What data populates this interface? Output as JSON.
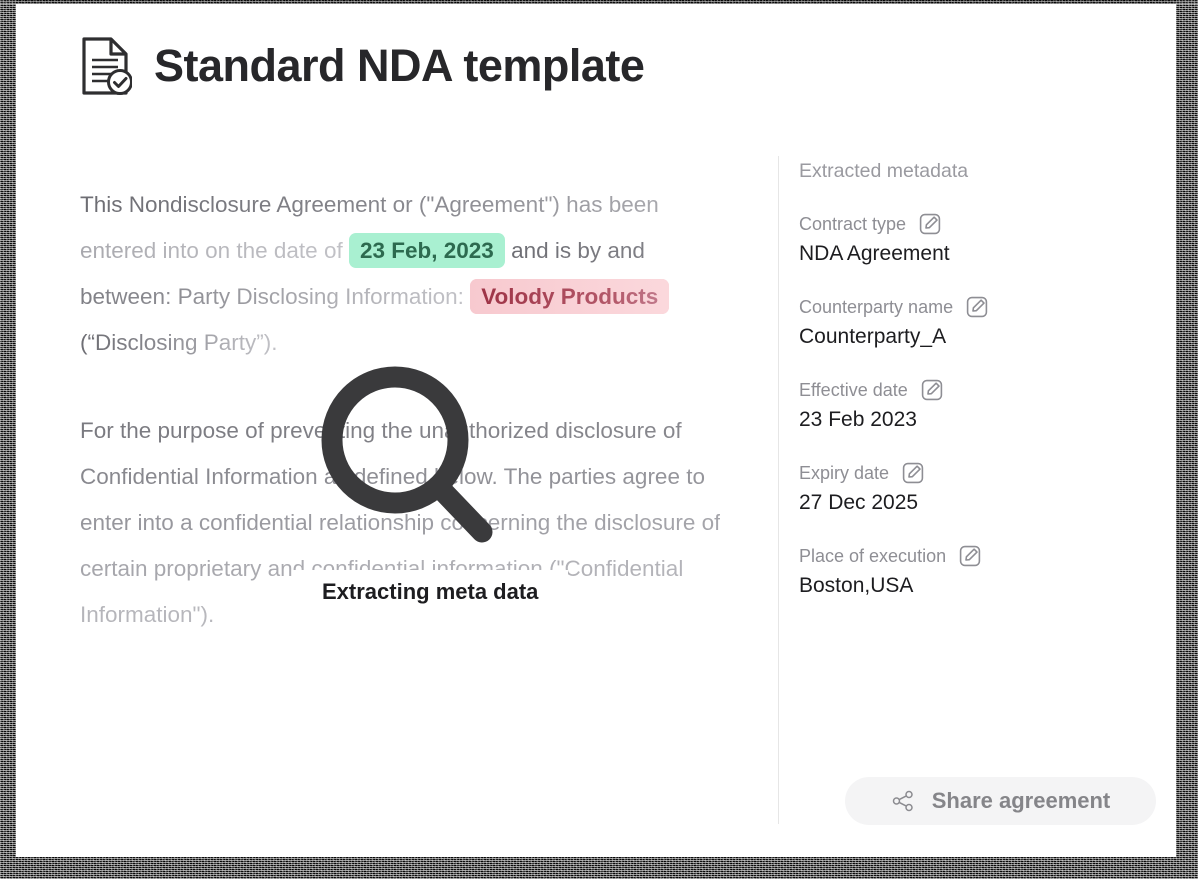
{
  "header": {
    "title": "Standard NDA template",
    "icon": "document-check-icon"
  },
  "document": {
    "paragraph1": {
      "part1": "This Nondisclosure Agreement or (\"Agreement\") has been entered into on the date of ",
      "highlight_date": "23 Feb, 2023",
      "part2": " and is by and between: Party Disclosing Information: ",
      "highlight_party": "Volody Products",
      "part3": " (“Disclosing Party”)."
    },
    "paragraph2": "For the purpose of preventing the unauthorized disclosure of Confidential Information as defined below. The parties agree to enter into a confidential relationship concerning the disclosure of certain proprietary and confidential information (\"Confidential Information\")."
  },
  "overlay": {
    "icon": "magnifying-glass-icon",
    "label": "Extracting meta data"
  },
  "sidebar": {
    "heading": "Extracted metadata",
    "edit_icon": "pencil-edit-icon",
    "fields": [
      {
        "label": "Contract type",
        "value": "NDA Agreement"
      },
      {
        "label": "Counterparty name",
        "value": "Counterparty_A"
      },
      {
        "label": "Effective date",
        "value": "23 Feb 2023"
      },
      {
        "label": "Expiry date",
        "value": "27 Dec 2025"
      },
      {
        "label": "Place of execution",
        "value": "Boston,USA"
      }
    ],
    "share_button": {
      "label": "Share agreement",
      "icon": "share-nodes-icon"
    }
  },
  "colors": {
    "highlight_date_bg": "#a9f0d1",
    "highlight_date_text": "#2d6a4f",
    "highlight_party_bg": "#f9d0d5",
    "highlight_party_text": "#9e3346",
    "title_text": "#27272a",
    "body_text": "#8c8c92",
    "share_button_bg": "#f4f4f5"
  }
}
